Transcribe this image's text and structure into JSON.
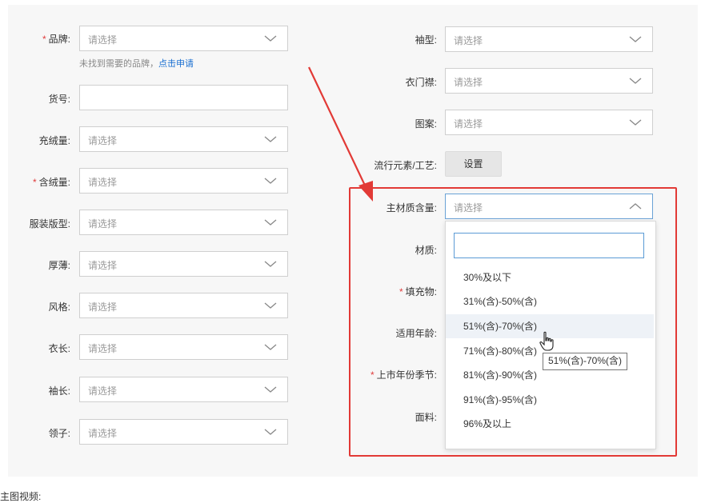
{
  "left_fields": [
    {
      "label": "品牌:",
      "required": true,
      "placeholder": "请选择",
      "type": "select"
    },
    {
      "label": "货号:",
      "required": false,
      "placeholder": "",
      "type": "input"
    },
    {
      "label": "充绒量:",
      "required": false,
      "placeholder": "请选择",
      "type": "select"
    },
    {
      "label": "含绒量:",
      "required": true,
      "placeholder": "请选择",
      "type": "select"
    },
    {
      "label": "服装版型:",
      "required": false,
      "placeholder": "请选择",
      "type": "select"
    },
    {
      "label": "厚薄:",
      "required": false,
      "placeholder": "请选择",
      "type": "select"
    },
    {
      "label": "风格:",
      "required": false,
      "placeholder": "请选择",
      "type": "select"
    },
    {
      "label": "衣长:",
      "required": false,
      "placeholder": "请选择",
      "type": "select"
    },
    {
      "label": "袖长:",
      "required": false,
      "placeholder": "请选择",
      "type": "select"
    },
    {
      "label": "领子:",
      "required": false,
      "placeholder": "请选择",
      "type": "select"
    }
  ],
  "brand_hint": {
    "text": "未找到需要的品牌，",
    "link": "点击申请"
  },
  "right_fields": [
    {
      "label": "袖型:",
      "placeholder": "请选择"
    },
    {
      "label": "衣门襟:",
      "placeholder": "请选择"
    },
    {
      "label": "图案:",
      "placeholder": "请选择"
    }
  ],
  "trend": {
    "label": "流行元素/工艺:",
    "button": "设置"
  },
  "material_content": {
    "label": "主材质含量:",
    "placeholder": "请选择"
  },
  "hidden_labels": {
    "material": "材质:",
    "filling": "填充物:",
    "age": "适用年龄:",
    "season": "上市年份季节:",
    "fabric": "面料:"
  },
  "dropdown": {
    "search_value": "",
    "options": [
      "30%及以下",
      "31%(含)-50%(含)",
      "51%(含)-70%(含)",
      "71%(含)-80%(含)",
      "81%(含)-90%(含)",
      "91%(含)-95%(含)",
      "96%及以上"
    ],
    "hovered_index": 2,
    "tooltip": "51%(含)-70%(含)"
  },
  "bottom_label": "主图视频:",
  "colors": {
    "required": "#e03c3c",
    "link": "#1a6fd1",
    "highlight_box": "#e23a36",
    "focus_border": "#5b9bd5"
  }
}
